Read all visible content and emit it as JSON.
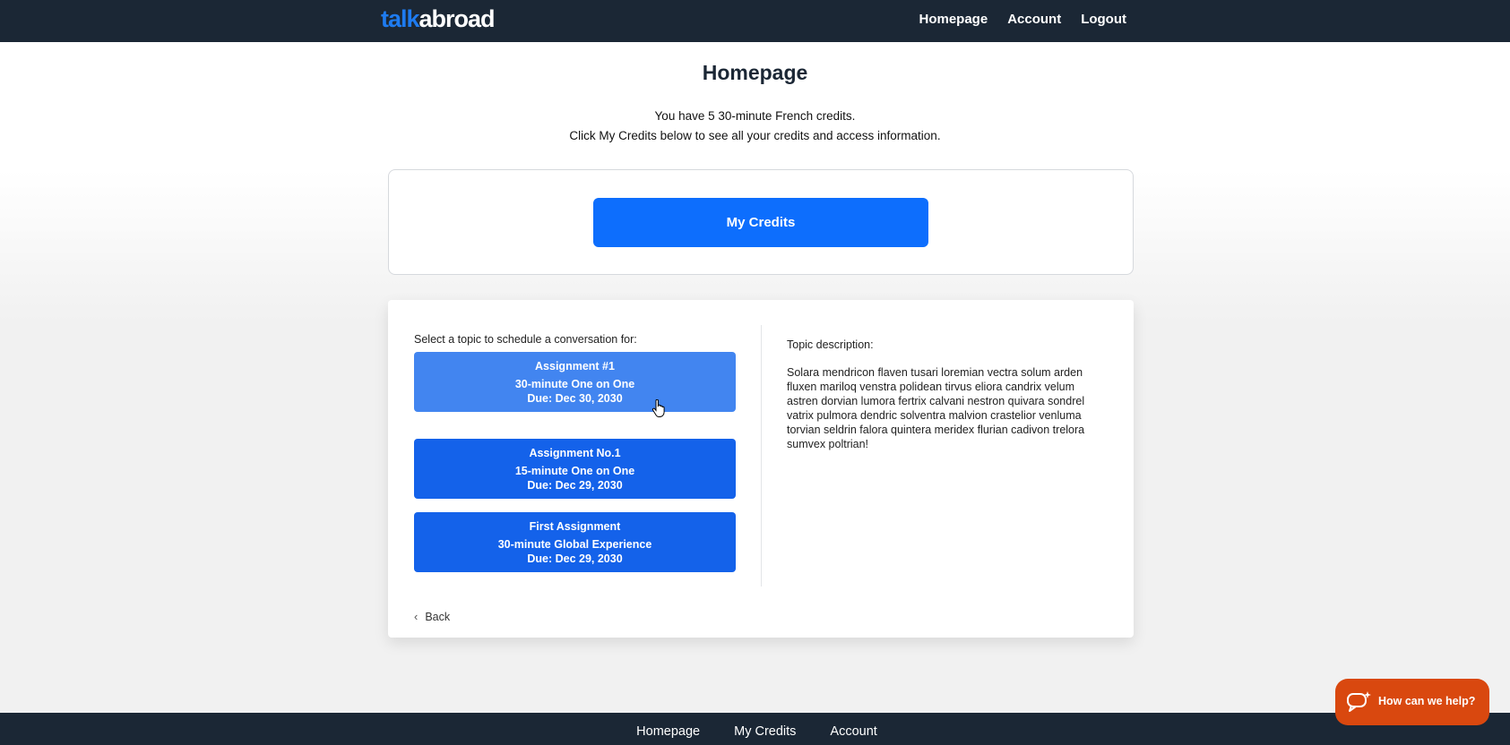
{
  "header": {
    "logo_part1": "talk",
    "logo_part2": "abroad",
    "nav": [
      "Homepage",
      "Account",
      "Logout"
    ]
  },
  "page": {
    "title": "Homepage",
    "info_line1": "You have 5 30-minute French credits.",
    "info_line2": "Click My Credits below to see all your credits and access information."
  },
  "credits": {
    "button_label": "My Credits"
  },
  "topics": {
    "select_label": "Select a topic to schedule a conversation for:",
    "items": [
      {
        "title": "Assignment #1",
        "type": "30-minute One on One",
        "due": "Due: Dec 30, 2030"
      },
      {
        "title": "Assignment No.1",
        "type": "15-minute One on One",
        "due": "Due: Dec 29, 2030"
      },
      {
        "title": "First Assignment",
        "type": "30-minute Global Experience",
        "due": "Due: Dec 29, 2030"
      }
    ],
    "description_label": "Topic description:",
    "description_text": "Solara mendricon flaven tusari loremian vectra solum arden fluxen mariloq venstra polidean tirvus eliora candrix velum astren dorvian lumora fertrix calvani nestron quivara sondrel vatrix pulmora dendric solventra malvion crastelior venluma torvian seldrin falora quintera meridex flurian cadivon trelora sumvex poltrian!",
    "back_label": "Back"
  },
  "footer": {
    "nav": [
      "Homepage",
      "My Credits",
      "Account"
    ]
  },
  "help_widget": {
    "label": "How can we help?",
    "icon": "chat-bubbles-icon"
  },
  "colors": {
    "nav_bg": "#1b2735",
    "primary": "#0d6efd",
    "assignment": "#1462ea",
    "assignment_hover": "#4285f0",
    "help": "#d9480f"
  }
}
